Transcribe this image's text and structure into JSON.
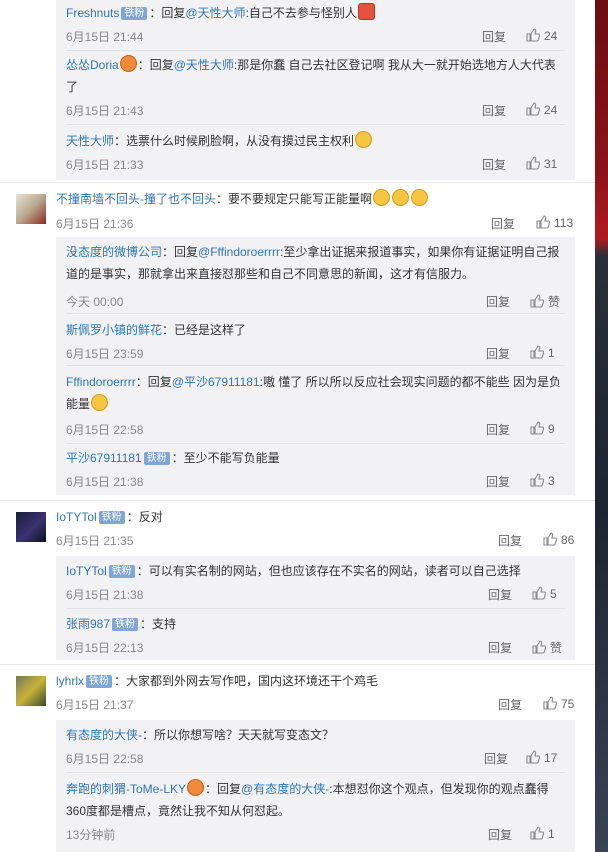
{
  "badge": "铁粉",
  "actions": {
    "reply": "回复",
    "like_zero": "赞"
  },
  "c0": {
    "r1": {
      "user": "Freshnuts",
      "reply_prefix": "：回复",
      "mention": "@天性大师",
      "text": ":自己不去参与怪别人",
      "time": "6月15日 21:44",
      "likes": "24"
    },
    "r2": {
      "user": "怂怂Doria",
      "reply_prefix": "：回复",
      "mention": "@天性大师",
      "text": ":那是你蠢 自己去社区登记啊 我从大一就开始选地方人大代表",
      "text2": "了",
      "time": "6月15日 21:43",
      "likes": "24"
    },
    "r3": {
      "user": "天性大师",
      "text": "：选票什么时候刷脸啊，从没有摸过民主权利",
      "time": "6月15日 21:33",
      "likes": "31"
    }
  },
  "c1": {
    "user": "不撞南墙不回头-撞了也不回头",
    "text": "：要不要规定只能写正能量啊",
    "time": "6月15日 21:36",
    "likes": "113",
    "r1": {
      "user": "没态度的微博公司",
      "reply_prefix": "：回复",
      "mention": "@Fffindoroerrrr",
      "text": ":至少拿出证据来报道事实，如果你有证据证明自己报",
      "text2": "道的是事实，那就拿出来直接怼那些和自己不同意思的新闻，这才有信服力。",
      "time": "今天 00:00"
    },
    "r2": {
      "user": "斯佩罗小镇的鲜花",
      "text": "：已经是这样了",
      "time": "6月15日 23:59",
      "likes": "1"
    },
    "r3": {
      "user": "Fffindoroerrrr",
      "reply_prefix": "：回复",
      "mention": "@平沙67911181",
      "text": ":嗷 懂了 所以所以反应社会现实问题的都不能些 因为是负",
      "text2": "能量",
      "time": "6月15日 22:58",
      "likes": "9"
    },
    "r4": {
      "user": "平沙67911181",
      "text": "：至少不能写负能量",
      "time": "6月15日 21:38",
      "likes": "3"
    }
  },
  "c2": {
    "user": "IoTYTol",
    "text": "：反对",
    "time": "6月15日 21:35",
    "likes": "86",
    "r1": {
      "user": "IoTYTol",
      "text": "：可以有实名制的网站，但也应该存在不实名的网站，读者可以自己选择",
      "time": "6月15日 21:38",
      "likes": "5"
    },
    "r2": {
      "user": "张雨987",
      "text": "：支持",
      "time": "6月15日 22:13"
    }
  },
  "c3": {
    "user": "lyhrlx",
    "text": "：大家都到外网去写作吧，国内这环境还干个鸡毛",
    "time": "6月15日 21:37",
    "likes": "75",
    "r1": {
      "user": "有态度的大侠-",
      "text": "：所以你想写啥？天天就写变态文？",
      "time": "6月15日 22:58",
      "likes": "17"
    },
    "r2": {
      "user": "奔跑的刺猬-ToMe-LKY",
      "reply_prefix": "：回复",
      "mention": "@有态度的大侠-",
      "text": ":本想怼你这个观点，但发现你的观点蠢得",
      "text2": "360度都是槽点，竟然让我不知从何怼起。",
      "time": "13分钟前",
      "likes": "1"
    }
  }
}
